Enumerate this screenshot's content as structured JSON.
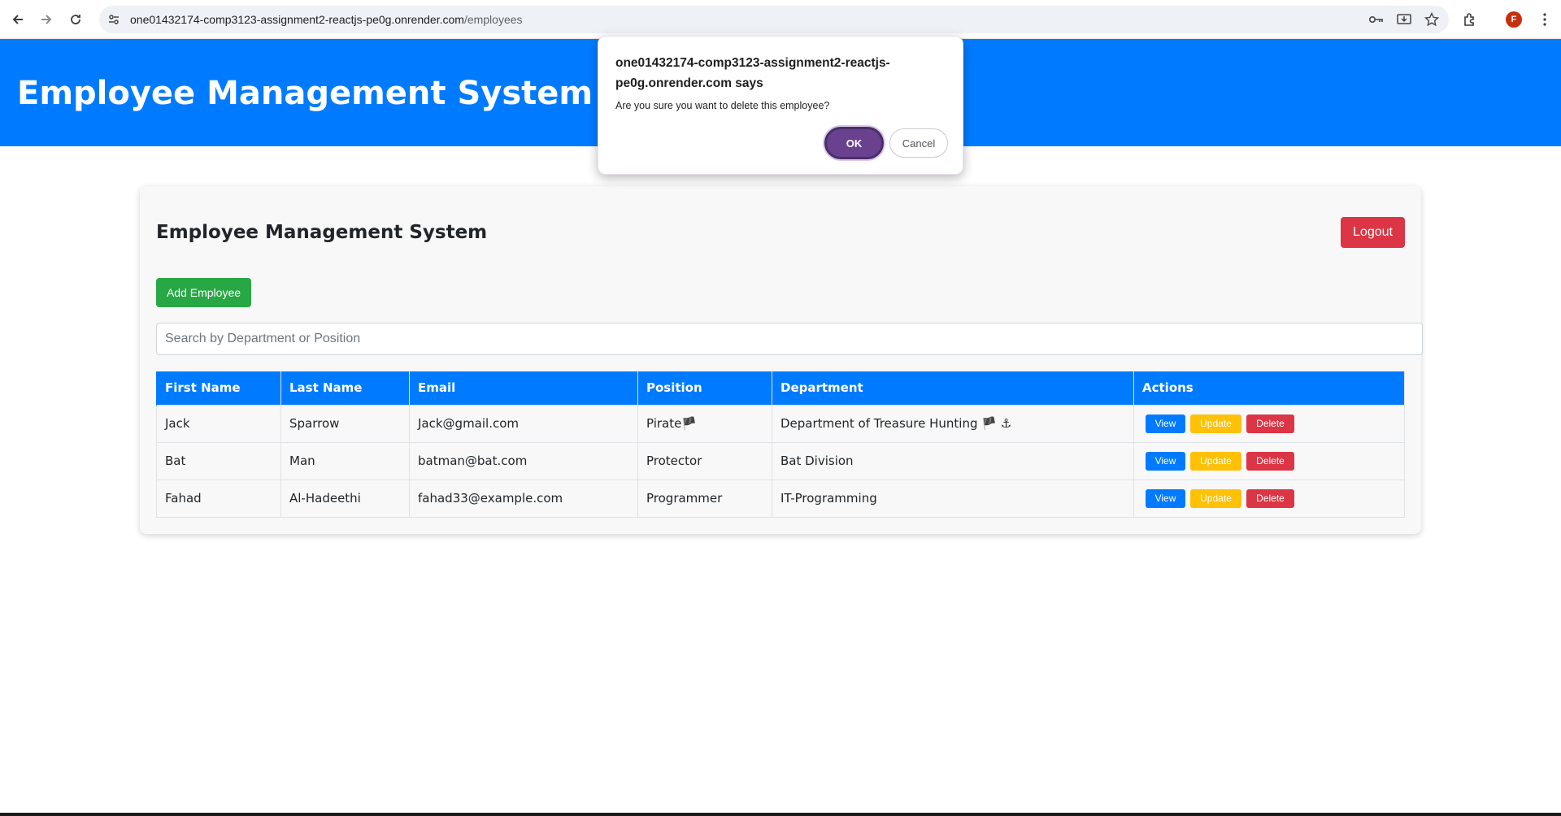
{
  "browser": {
    "url_host": "one01432174-comp3123-assignment2-reactjs-pe0g.onrender.com",
    "url_path": "/employees",
    "profile_initial": "F"
  },
  "header": {
    "title": "Employee Management System"
  },
  "card": {
    "title": "Employee Management System",
    "logout_label": "Logout",
    "add_label": "Add Employee",
    "search_placeholder": "Search by Department or Position"
  },
  "table": {
    "columns": [
      "First Name",
      "Last Name",
      "Email",
      "Position",
      "Department",
      "Actions"
    ],
    "rows": [
      {
        "first": "Jack",
        "last": "Sparrow",
        "email": "Jack@gmail.com",
        "position": "Pirate🏴",
        "department": "Department of Treasure Hunting 🏴 ⚓"
      },
      {
        "first": "Bat",
        "last": "Man",
        "email": "batman@bat.com",
        "position": "Protector",
        "department": "Bat Division"
      },
      {
        "first": "Fahad",
        "last": "Al-Hadeethi",
        "email": "fahad33@example.com",
        "position": "Programmer",
        "department": "IT-Programming"
      }
    ],
    "actions": {
      "view": "View",
      "update": "Update",
      "delete": "Delete"
    }
  },
  "dialog": {
    "title": "one01432174-comp3123-assignment2-reactjs-pe0g.onrender.com says",
    "message": "Are you sure you want to delete this employee?",
    "ok_label": "OK",
    "cancel_label": "Cancel"
  },
  "colors": {
    "primary": "#007bff",
    "success": "#28a745",
    "warning": "#ffc107",
    "danger": "#dc3545",
    "dialog_ok": "#69418f"
  }
}
